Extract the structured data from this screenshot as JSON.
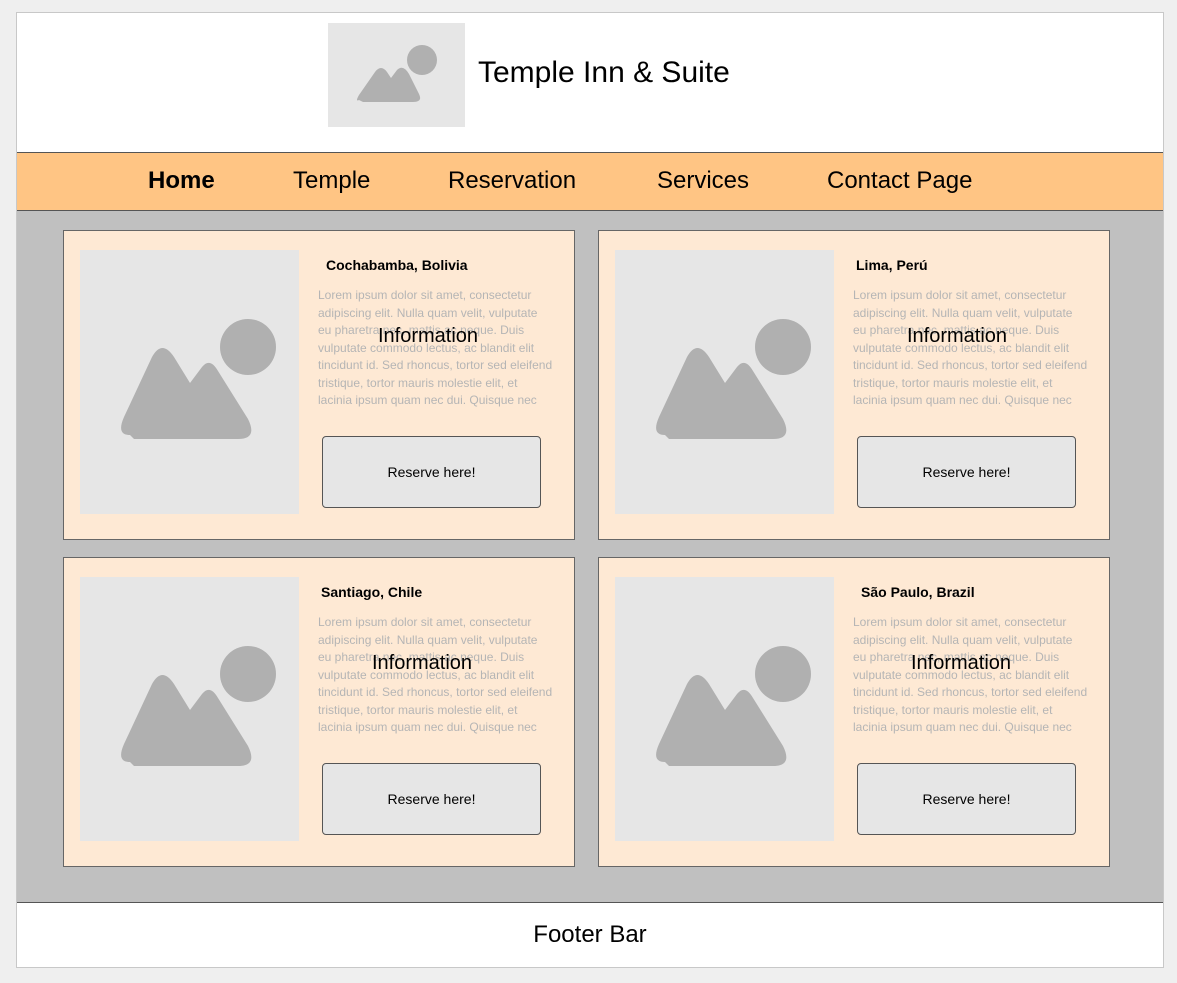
{
  "header": {
    "logo_icon": "image-placeholder-icon",
    "title": "Temple Inn & Suite"
  },
  "nav": {
    "items": [
      {
        "label": "Home",
        "active": true
      },
      {
        "label": "Temple",
        "active": false
      },
      {
        "label": "Reservation",
        "active": false
      },
      {
        "label": "Services",
        "active": false
      },
      {
        "label": "Contact Page",
        "active": false
      }
    ]
  },
  "cards": [
    {
      "title": "Cochabamba, Bolivia",
      "description": "Lorem ipsum dolor sit amet, consectetur adipiscing elit. Nulla quam velit, vulputate eu pharetra nec, mattis ac neque. Duis vulputate commodo lectus, ac blandit elit tincidunt id. Sed rhoncus, tortor sed eleifend tristique, tortor mauris molestie elit, et lacinia ipsum quam nec dui. Quisque nec",
      "info_label": "Information",
      "button_label": "Reserve here!"
    },
    {
      "title": "Lima, Perú",
      "description": "Lorem ipsum dolor sit amet, consectetur adipiscing elit. Nulla quam velit, vulputate eu pharetra nec, mattis ac neque. Duis vulputate commodo lectus, ac blandit elit tincidunt id. Sed rhoncus, tortor sed eleifend tristique, tortor mauris molestie elit, et lacinia ipsum quam nec dui. Quisque nec",
      "info_label": "Information",
      "button_label": "Reserve here!"
    },
    {
      "title": "Santiago, Chile",
      "description": "Lorem ipsum dolor sit amet, consectetur adipiscing elit. Nulla quam velit, vulputate eu pharetra nec, mattis ac neque. Duis vulputate commodo lectus, ac blandit elit tincidunt id. Sed rhoncus, tortor sed eleifend tristique, tortor mauris molestie elit, et lacinia ipsum quam nec dui. Quisque nec",
      "info_label": "Information",
      "button_label": "Reserve here!"
    },
    {
      "title": "São Paulo, Brazil",
      "description": "Lorem ipsum dolor sit amet, consectetur adipiscing elit. Nulla quam velit, vulputate eu pharetra nec, mattis ac neque. Duis vulputate commodo lectus, ac blandit elit tincidunt id. Sed rhoncus, tortor sed eleifend tristique, tortor mauris molestie elit, et lacinia ipsum quam nec dui. Quisque nec",
      "info_label": "Information",
      "button_label": "Reserve here!"
    }
  ],
  "footer": {
    "label": "Footer Bar"
  },
  "colors": {
    "nav_background": "#ffc584",
    "card_background": "#fee9d4",
    "main_background": "#c0c0c0",
    "placeholder_background": "#e6e6e6",
    "placeholder_icon": "#b0b0b0"
  }
}
